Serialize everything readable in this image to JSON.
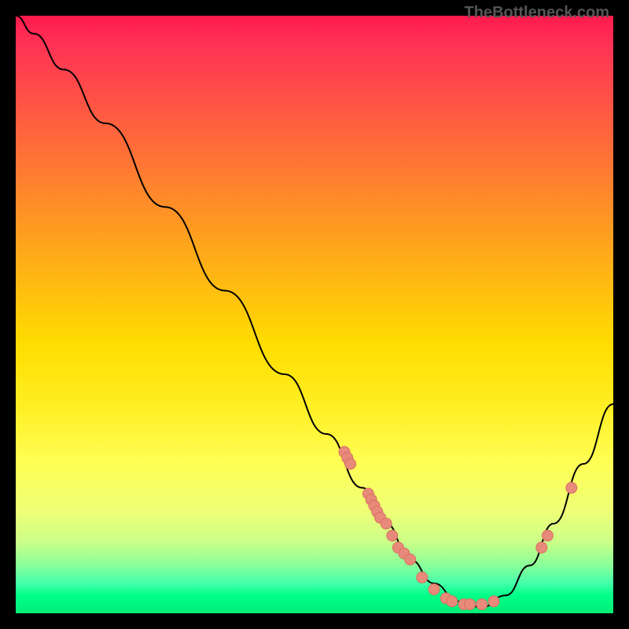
{
  "watermark": "TheBottleneck.com",
  "chart_data": {
    "type": "line",
    "title": "",
    "xlabel": "",
    "ylabel": "",
    "xlim": [
      0,
      100
    ],
    "ylim": [
      0,
      100
    ],
    "curve_points": [
      {
        "x": 0,
        "y": 100
      },
      {
        "x": 3,
        "y": 97
      },
      {
        "x": 8,
        "y": 91
      },
      {
        "x": 15,
        "y": 82
      },
      {
        "x": 25,
        "y": 68
      },
      {
        "x": 35,
        "y": 54
      },
      {
        "x": 45,
        "y": 40
      },
      {
        "x": 52,
        "y": 30
      },
      {
        "x": 58,
        "y": 21
      },
      {
        "x": 62,
        "y": 15
      },
      {
        "x": 66,
        "y": 9
      },
      {
        "x": 70,
        "y": 5
      },
      {
        "x": 74,
        "y": 2
      },
      {
        "x": 78,
        "y": 1
      },
      {
        "x": 82,
        "y": 3
      },
      {
        "x": 86,
        "y": 8
      },
      {
        "x": 90,
        "y": 15
      },
      {
        "x": 95,
        "y": 25
      },
      {
        "x": 100,
        "y": 35
      }
    ],
    "data_points": [
      {
        "x": 55,
        "y": 27
      },
      {
        "x": 55.5,
        "y": 26
      },
      {
        "x": 56,
        "y": 25
      },
      {
        "x": 59,
        "y": 20
      },
      {
        "x": 59.5,
        "y": 19
      },
      {
        "x": 60,
        "y": 18
      },
      {
        "x": 60.5,
        "y": 17
      },
      {
        "x": 61,
        "y": 16
      },
      {
        "x": 62,
        "y": 15
      },
      {
        "x": 63,
        "y": 13
      },
      {
        "x": 64,
        "y": 11
      },
      {
        "x": 65,
        "y": 10
      },
      {
        "x": 66,
        "y": 9
      },
      {
        "x": 68,
        "y": 6
      },
      {
        "x": 70,
        "y": 4
      },
      {
        "x": 72,
        "y": 2.5
      },
      {
        "x": 73,
        "y": 2
      },
      {
        "x": 75,
        "y": 1.5
      },
      {
        "x": 76,
        "y": 1.5
      },
      {
        "x": 78,
        "y": 1.5
      },
      {
        "x": 80,
        "y": 2
      },
      {
        "x": 88,
        "y": 11
      },
      {
        "x": 89,
        "y": 13
      },
      {
        "x": 93,
        "y": 21
      }
    ]
  }
}
